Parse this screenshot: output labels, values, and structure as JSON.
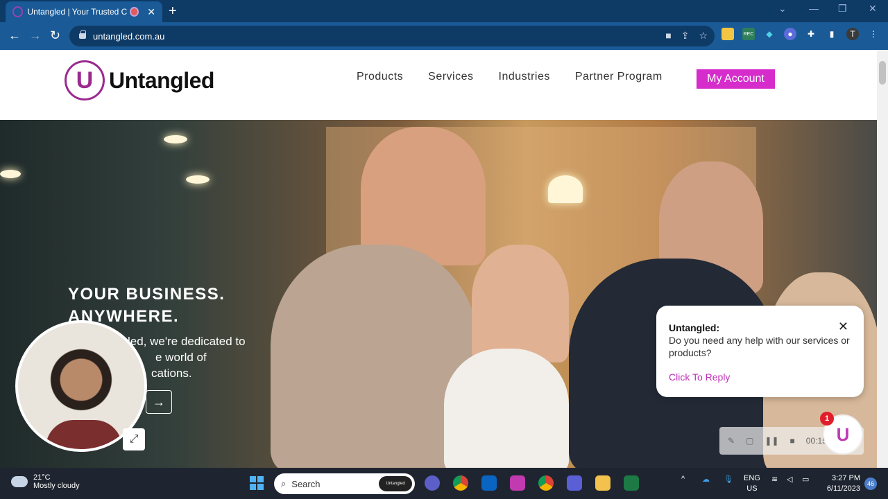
{
  "browser": {
    "tab_title": "Untangled | Your Trusted Cl",
    "url": "untangled.com.au"
  },
  "site": {
    "logo_mark": "U",
    "logo_text": "Untangled",
    "nav": [
      "Products",
      "Services",
      "Industries",
      "Partner Program"
    ],
    "account_button": "My Account"
  },
  "hero": {
    "title_line1": "YOUR BUSINESS.",
    "title_line2": "ANYWHERE.",
    "sub_line1": "led, we're dedicated to",
    "sub_line2": "e world of",
    "sub_line3": "cations."
  },
  "chat": {
    "sender": "Untangled:",
    "message": "Do you need any help with our services or products?",
    "reply": "Click To Reply",
    "unread_count": "1"
  },
  "recorder": {
    "timer": "00:15"
  },
  "taskbar": {
    "temperature": "21°C",
    "weather": "Mostly cloudy",
    "search_placeholder": "Search",
    "search_badge": "Untangled",
    "lang_line1": "ENG",
    "lang_line2": "US",
    "time": "3:27 PM",
    "date": "6/11/2023",
    "notifications": "46"
  }
}
